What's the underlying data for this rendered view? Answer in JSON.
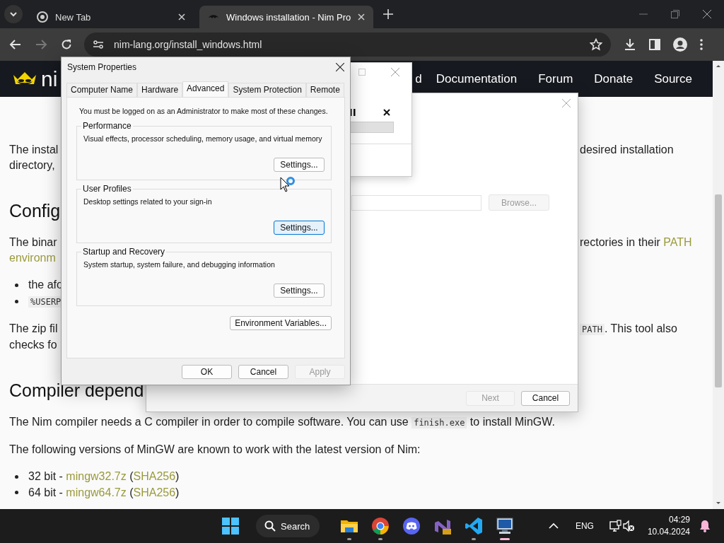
{
  "browser": {
    "tabs": [
      {
        "title": "New Tab",
        "selected": false
      },
      {
        "title": "Windows installation - Nim Pro",
        "selected": true
      }
    ],
    "nav_buttons": [
      {
        "kind": "back",
        "disabled": false
      },
      {
        "kind": "forward",
        "disabled": true
      },
      {
        "kind": "reload",
        "disabled": false
      }
    ],
    "url": "nim-lang.org/install_windows.html"
  },
  "page": {
    "logo_text": "ni",
    "nav_links": [
      "d",
      "Documentation",
      "Forum",
      "Donate",
      "Source"
    ],
    "blocks": [
      {
        "kind": "para",
        "lines": [
          {
            "left": [
              {
                "kind": "text",
                "text": "The instal"
              }
            ],
            "right": [
              {
                "kind": "text",
                "text": "desired installation"
              }
            ]
          },
          {
            "left": [
              {
                "kind": "text",
                "text": "directory,"
              }
            ]
          }
        ]
      },
      {
        "kind": "heading",
        "text": "Config"
      },
      {
        "kind": "para",
        "lines": [
          {
            "left": [
              {
                "kind": "text",
                "text": "The binar"
              }
            ],
            "right": [
              {
                "kind": "text",
                "text": "rectories in their "
              },
              {
                "kind": "link",
                "text": "PATH"
              }
            ]
          },
          {
            "left": [
              {
                "kind": "link",
                "text": "environm"
              }
            ]
          }
        ]
      },
      {
        "kind": "bullets",
        "items": [
          [
            {
              "kind": "text",
              "text": "the afo"
            }
          ],
          [
            {
              "kind": "code",
              "text": "%USERP"
            }
          ]
        ]
      },
      {
        "kind": "para",
        "lines": [
          {
            "left": [
              {
                "kind": "text",
                "text": "The zip fil"
              }
            ],
            "right": [
              {
                "kind": "code",
                "text": "PATH"
              },
              {
                "kind": "text",
                "text": ". This tool also"
              }
            ]
          },
          {
            "left": [
              {
                "kind": "text",
                "text": "checks fo"
              }
            ]
          }
        ]
      },
      {
        "kind": "heading",
        "text": "Compiler depend"
      },
      {
        "kind": "para",
        "lines": [
          {
            "left": [
              {
                "kind": "text",
                "text": "The Nim compiler needs a C compiler in order to compile software. You can use "
              },
              {
                "kind": "code",
                "text": "finish.exe"
              },
              {
                "kind": "text",
                "text": " to install MinGW."
              }
            ]
          }
        ]
      },
      {
        "kind": "para",
        "lines": [
          {
            "left": [
              {
                "kind": "text",
                "text": "The following versions of MinGW are known to work with the latest version of Nim:"
              }
            ]
          }
        ]
      },
      {
        "kind": "bullets",
        "items": [
          [
            {
              "kind": "text",
              "text": "32 bit - "
            },
            {
              "kind": "link",
              "text": "mingw32.7z"
            },
            {
              "kind": "text",
              "text": " ("
            },
            {
              "kind": "link",
              "text": "SHA256"
            },
            {
              "kind": "text",
              "text": ")"
            }
          ],
          [
            {
              "kind": "text",
              "text": "64 bit - "
            },
            {
              "kind": "link",
              "text": "mingw64.7z"
            },
            {
              "kind": "text",
              "text": " ("
            },
            {
              "kind": "link",
              "text": "SHA256"
            },
            {
              "kind": "text",
              "text": ")"
            }
          ]
        ]
      }
    ]
  },
  "system_properties": {
    "title": "System Properties",
    "tabs": [
      {
        "label": "Computer Name",
        "selected": false
      },
      {
        "label": "Hardware",
        "selected": false
      },
      {
        "label": "Advanced",
        "selected": true
      },
      {
        "label": "System Protection",
        "selected": false
      },
      {
        "label": "Remote",
        "selected": false
      }
    ],
    "note": "You must be logged on as an Administrator to make most of these changes.",
    "groups": [
      {
        "title": "Performance",
        "description": "Visual effects, processor scheduling, memory usage, and virtual memory",
        "button": "Settings...",
        "highlighted": false
      },
      {
        "title": "User Profiles",
        "description": "Desktop settings related to your sign-in",
        "button": "Settings...",
        "highlighted": true
      },
      {
        "title": "Startup and Recovery",
        "description": "System startup, system failure, and debugging information",
        "button": "Settings...",
        "highlighted": false
      }
    ],
    "environment_button": "Environment Variables...",
    "buttons": [
      {
        "label": "OK",
        "disabled": false
      },
      {
        "label": "Cancel",
        "disabled": false
      },
      {
        "label": "Apply",
        "disabled": true
      }
    ]
  },
  "installer": {
    "browse_button": {
      "label": "Browse...",
      "disabled": true
    },
    "footer_buttons": [
      {
        "label": "Next",
        "disabled": true
      },
      {
        "label": "Cancel",
        "disabled": false
      }
    ]
  },
  "taskbar": {
    "search_label": "Search",
    "apps": [
      {
        "kind": "files",
        "running": true,
        "selected": false
      },
      {
        "kind": "browser",
        "running": true,
        "selected": false
      },
      {
        "kind": "chat",
        "running": false,
        "selected": false
      },
      {
        "kind": "ide",
        "running": false,
        "selected": false
      },
      {
        "kind": "editor",
        "running": true,
        "selected": false
      },
      {
        "kind": "remote",
        "running": true,
        "selected": true
      }
    ],
    "language": "ENG",
    "time": "04:29",
    "date": "10.04.2024"
  }
}
